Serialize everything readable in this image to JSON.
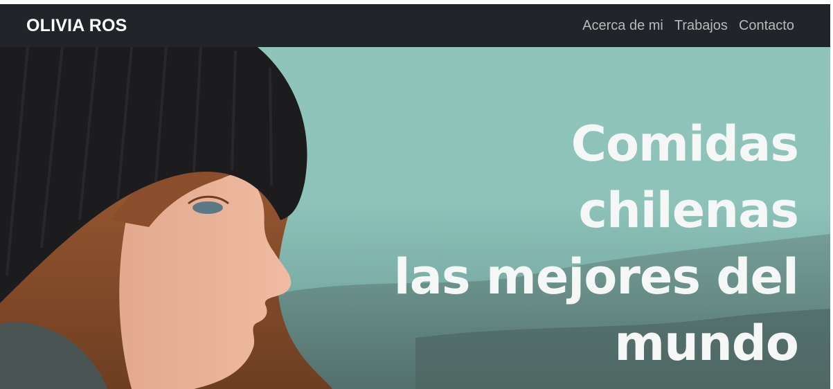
{
  "navbar": {
    "brand": "OLIVIA ROS",
    "links": [
      {
        "label": "Acerca de mi"
      },
      {
        "label": "Trabajos"
      },
      {
        "label": "Contacto"
      }
    ]
  },
  "hero": {
    "headline_lines": [
      "Comidas",
      "chilenas",
      "las mejores del",
      "mundo"
    ],
    "photo": "woman-in-black-beanie-photo"
  },
  "colors": {
    "navbar_bg": "#212529",
    "brand_text": "#ffffff",
    "nav_link_text": "#b7b9bb",
    "hero_sky": "#8fc4bb",
    "headline_text": "#f5f7f6"
  }
}
